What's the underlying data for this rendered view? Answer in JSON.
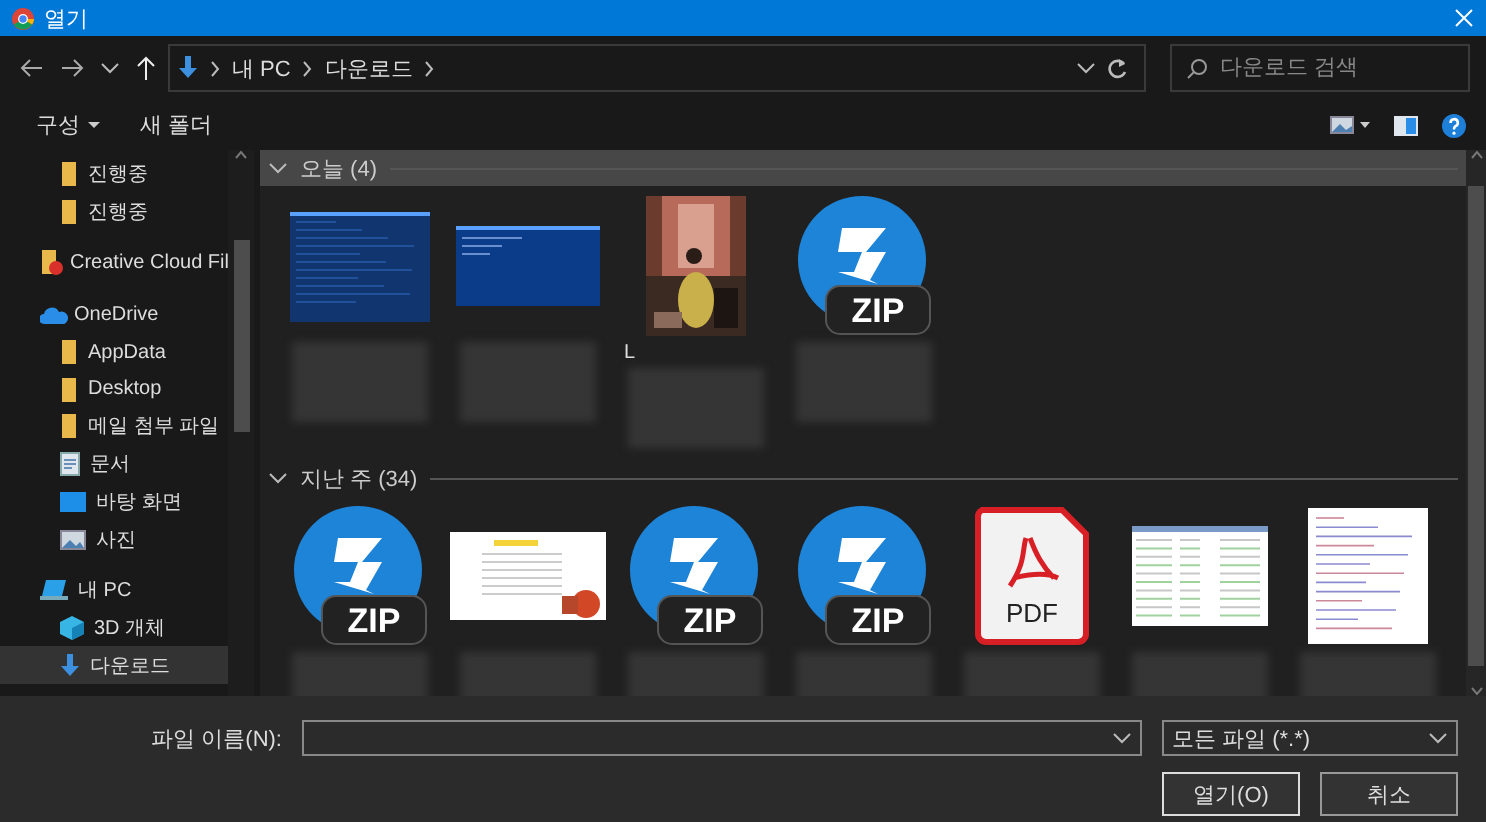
{
  "window": {
    "title": "열기"
  },
  "address": {
    "crumbs": [
      "내 PC",
      "다운로드"
    ]
  },
  "search": {
    "placeholder": "다운로드 검색"
  },
  "toolbar": {
    "organize": "구성",
    "new_folder": "새 폴더"
  },
  "sidebar": {
    "items": [
      {
        "children": [
          {
            "label": "진행중",
            "kind": "folder",
            "selected": false
          },
          {
            "label": "진행중",
            "kind": "folder",
            "selected": false
          }
        ]
      },
      {
        "label": "Creative Cloud Fil",
        "kind": "ccfolder",
        "selected": false
      },
      {
        "label": "OneDrive",
        "kind": "cloud",
        "selected": false,
        "children": [
          {
            "label": "AppData",
            "kind": "folder",
            "selected": false
          },
          {
            "label": "Desktop",
            "kind": "folder",
            "selected": false
          },
          {
            "label": "메일 첨부 파일",
            "kind": "folder",
            "selected": false
          },
          {
            "label": "문서",
            "kind": "doc",
            "selected": false
          },
          {
            "label": "바탕 화면",
            "kind": "desktop",
            "selected": false
          },
          {
            "label": "사진",
            "kind": "pictures",
            "selected": false
          }
        ]
      },
      {
        "label": "내 PC",
        "kind": "pc",
        "selected": false,
        "children": [
          {
            "label": "3D 개체",
            "kind": "cube",
            "selected": false
          },
          {
            "label": "다운로드",
            "kind": "download",
            "selected": true
          }
        ]
      }
    ]
  },
  "groups": [
    {
      "title": "오늘 (4)",
      "selected": true,
      "files": [
        {
          "kind": "screenshot"
        },
        {
          "kind": "screenshot-small"
        },
        {
          "caption": "L"
        },
        {
          "kind": "zip",
          "badge": "ZIP"
        }
      ]
    },
    {
      "title": "지난 주 (34)",
      "selected": false,
      "files": [
        {
          "kind": "zip",
          "badge": "ZIP"
        },
        {
          "kind": "slides"
        },
        {
          "kind": "zip",
          "badge": "ZIP"
        },
        {
          "kind": "zip",
          "badge": "ZIP"
        },
        {
          "kind": "pdf",
          "badge": "PDF"
        },
        {
          "kind": "sheet"
        },
        {
          "kind": "text"
        }
      ]
    }
  ],
  "footer": {
    "filename_label": "파일 이름(N):",
    "filter": "모든 파일 (*.*)",
    "buttons": [
      "열기(O)",
      "취소"
    ]
  }
}
